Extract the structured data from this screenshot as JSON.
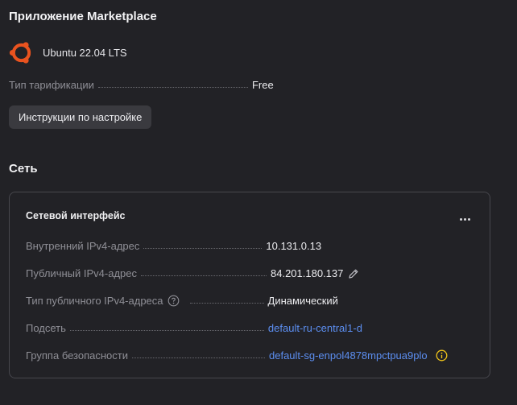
{
  "marketplace": {
    "title": "Приложение Marketplace",
    "app_icon": "ubuntu-logo",
    "app_name": "Ubuntu 22.04 LTS",
    "billing_label": "Тип тарификации",
    "billing_value": "Free",
    "setup_button": "Инструкции по настройке"
  },
  "network": {
    "title": "Сеть",
    "card": {
      "title": "Сетевой интерфейс",
      "more_icon": "ellipsis-icon",
      "rows": [
        {
          "label": "Внутренний IPv4-адрес",
          "value": "10.131.0.13"
        },
        {
          "label": "Публичный IPv4-адрес",
          "value": "84.201.180.137",
          "icon": "pencil-icon"
        },
        {
          "label": "Тип публичного IPv4-адреса",
          "value": "Динамический",
          "label_icon": "help-icon"
        },
        {
          "label": "Подсеть",
          "value": "default-ru-central1-d",
          "link": true
        },
        {
          "label": "Группа безопасности",
          "value": "default-sg-enpol4878mpctpua9plo",
          "link": true,
          "icon": "info-icon"
        }
      ]
    }
  },
  "colors": {
    "background": "#222226",
    "link": "#5c8ef0",
    "ubuntu_orange": "#e9531f",
    "warning": "#f0c419"
  }
}
